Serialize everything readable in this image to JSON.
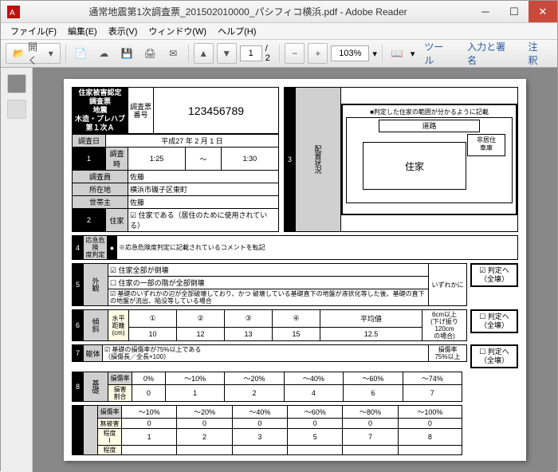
{
  "window": {
    "title": "通常地震第1次調査票_201502010000_パシフィコ横浜.pdf - Adobe Reader"
  },
  "menu": {
    "file": "ファイル(F)",
    "edit": "編集(E)",
    "view": "表示(V)",
    "window": "ウィンドウ(W)",
    "help": "ヘルプ(H)"
  },
  "toolbar": {
    "open_label": "開く",
    "page_current": "1",
    "page_sep_total": "/ 2",
    "zoom": "103%",
    "tab_tool": "ツール",
    "tab_sign": "入力と署名",
    "tab_note": "注釈"
  },
  "doc": {
    "header_block": {
      "l1": "住家被害認定",
      "l2": "調査票",
      "l3": "地震",
      "l4": "木造・プレハブ",
      "l5": "第１次Ａ",
      "survey_no_label": "調査票\n番号",
      "survey_no": "123456789"
    },
    "row1": {
      "label": "調査日",
      "val": "平成27 年 2 月 1 日"
    },
    "row2": {
      "num": "1",
      "label": "調査時",
      "from": "1:25",
      "sep": "～",
      "to": "1:30"
    },
    "row3": {
      "label": "調査員",
      "val": "佐藤"
    },
    "row4": {
      "label": "所在地",
      "val": "横浜市磯子区東町"
    },
    "row5": {
      "label": "世帯主",
      "val": "佐藤"
    },
    "row6": {
      "num": "2",
      "label": "住家",
      "cb": "☑",
      "text": "住家である（居住のために使用されている）"
    },
    "diagram": {
      "num": "3",
      "label": "配置状況",
      "note": "■判定した住家の範囲が分かるように記載",
      "road": "道路",
      "house": "住家",
      "nonres": "非居住\n車庫"
    },
    "sec4": {
      "num": "4",
      "l1": "応急危険",
      "l2": "度判定",
      "sub": "●",
      "text": "※応急危険度判定に記載されているコメントを転記"
    },
    "sec5": {
      "num": "5",
      "label": "外観",
      "i1": {
        "cb": "☑",
        "t": "住家全部が倒壊"
      },
      "i2": {
        "cb": "☐",
        "t": "住家の一部の階が全部倒壊"
      },
      "i3": {
        "cb": "☑",
        "t": "基礎のいずれかの辺が全部破壊しており、かつ 破壊している基礎直下の地盤が液状化等した後、基礎の直下の地盤が流出、陥没等している場合"
      },
      "side": "いずれかに",
      "judge": "☑ 判定へ\n（全壊）"
    },
    "sec6": {
      "num": "6",
      "label": "傾斜",
      "sub": "水平\n距離\n(cm)",
      "cols": [
        "①",
        "②",
        "③",
        "④",
        "平均値"
      ],
      "vals": [
        "10",
        "12",
        "13",
        "15",
        "12.5"
      ],
      "side": "6cm以上\n(下げ振り120cm\nの場合)",
      "judge": "☐ 判定へ\n（全壊）"
    },
    "sec7": {
      "num": "7",
      "label": "躯体",
      "cb": "☑",
      "text": "基礎の損傷率が75%以上である\n（損傷長／全長×100）",
      "side": "損傷率\n75%以上",
      "judge": "☐ 判定へ\n（全壊）"
    },
    "sec8": {
      "num": "8",
      "label": "基礎",
      "r1": {
        "lab": "損傷率",
        "cols": [
          "0%",
          "～10%",
          "～20%",
          "～40%",
          "～60%",
          "～74%"
        ]
      },
      "r2": {
        "lab": "損害\n割合",
        "vals": [
          "0",
          "1",
          "2",
          "4",
          "6",
          "7"
        ]
      }
    },
    "sec9": {
      "r1": {
        "lab": "損傷率",
        "cols": [
          "～10%",
          "～20%",
          "～40%",
          "～60%",
          "～80%",
          "～100%"
        ]
      },
      "r2": {
        "lab": "無被害",
        "vals": [
          "0",
          "0",
          "0",
          "0",
          "0",
          "0"
        ]
      },
      "r3": {
        "lab": "程度\nⅠ",
        "vals": [
          "1",
          "2",
          "3",
          "5",
          "7",
          "8"
        ]
      },
      "r4": {
        "lab": "程度",
        "vals": [
          "",
          "",
          "",
          "",
          "",
          ""
        ]
      }
    }
  }
}
